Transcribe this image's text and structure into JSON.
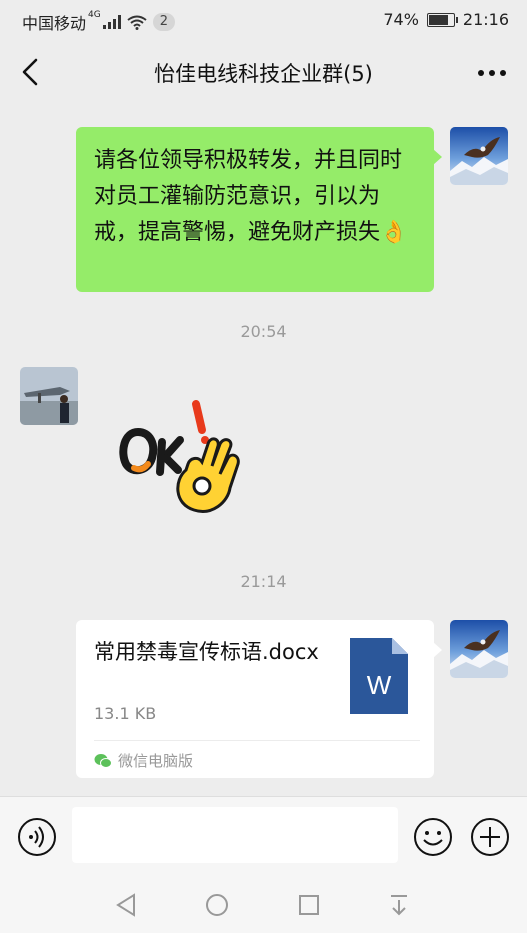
{
  "status_bar": {
    "carrier": "中国移动",
    "network": "4G",
    "notification_count": "2",
    "battery_percent": "74%",
    "battery_level": 0.74,
    "time": "21:16"
  },
  "header": {
    "title": "怡佳电线科技企业群(5)",
    "back_icon": "back-arrow-icon",
    "more_icon": "more-dots-icon"
  },
  "messages": [
    {
      "type": "text",
      "sender": "self",
      "text": "请各位领导积极转发，并且同时对员工灌输防范意识，引以为戒，提高警惕，避免财产损失👌",
      "bubble_color": "#95ec69"
    },
    {
      "type": "timestamp",
      "text": "20:54"
    },
    {
      "type": "sticker",
      "sender": "other",
      "sticker": "ok-hand-sticker",
      "sticker_text": "OK!"
    },
    {
      "type": "timestamp",
      "text": "21:14"
    },
    {
      "type": "file",
      "sender": "self",
      "file_name": "常用禁毒宣传标语.docx",
      "file_size": "13.1 KB",
      "file_icon": "word-document-icon",
      "file_icon_letter": "W",
      "source": "微信电脑版"
    }
  ],
  "input_bar": {
    "voice_icon": "voice-icon",
    "text_value": "",
    "emoji_icon": "emoji-icon",
    "plus_icon": "plus-icon"
  },
  "colors": {
    "background": "#ededed",
    "self_bubble": "#95ec69",
    "word_blue": "#2b579a"
  }
}
